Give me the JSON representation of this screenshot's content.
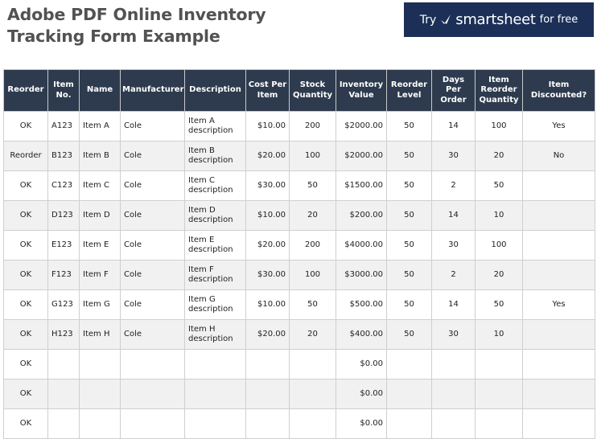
{
  "title": "Adobe PDF Online Inventory Tracking Form Example",
  "promo": {
    "try": "Try",
    "brand": "smartsheet",
    "free": "for free",
    "color": "#1b2f57"
  },
  "table": {
    "headers": [
      "Reorder",
      "Item No.",
      "Name",
      "Manufacturer",
      "Description",
      "Cost Per Item",
      "Stock Quantity",
      "Inventory Value",
      "Reorder Level",
      "Days Per Order",
      "Item Reorder Quantity",
      "Item Discounted?"
    ],
    "rows": [
      [
        "OK",
        "A123",
        "Item A",
        "Cole",
        "Item A description",
        "$10.00",
        "200",
        "$2000.00",
        "50",
        "14",
        "100",
        "Yes"
      ],
      [
        "Reorder",
        "B123",
        "Item B",
        "Cole",
        "Item B description",
        "$20.00",
        "100",
        "$2000.00",
        "50",
        "30",
        "20",
        "No"
      ],
      [
        "OK",
        "C123",
        "Item C",
        "Cole",
        "Item C description",
        "$30.00",
        "50",
        "$1500.00",
        "50",
        "2",
        "50",
        ""
      ],
      [
        "OK",
        "D123",
        "Item D",
        "Cole",
        "Item D description",
        "$10.00",
        "20",
        "$200.00",
        "50",
        "14",
        "10",
        ""
      ],
      [
        "OK",
        "E123",
        "Item E",
        "Cole",
        "Item E description",
        "$20.00",
        "200",
        "$4000.00",
        "50",
        "30",
        "100",
        ""
      ],
      [
        "OK",
        "F123",
        "Item F",
        "Cole",
        "Item F description",
        "$30.00",
        "100",
        "$3000.00",
        "50",
        "2",
        "20",
        ""
      ],
      [
        "OK",
        "G123",
        "Item G",
        "Cole",
        "Item G description",
        "$10.00",
        "50",
        "$500.00",
        "50",
        "14",
        "50",
        "Yes"
      ],
      [
        "OK",
        "H123",
        "Item H",
        "Cole",
        "Item H description",
        "$20.00",
        "20",
        "$400.00",
        "50",
        "30",
        "10",
        ""
      ],
      [
        "OK",
        "",
        "",
        "",
        "",
        "",
        "",
        "$0.00",
        "",
        "",
        "",
        ""
      ],
      [
        "OK",
        "",
        "",
        "",
        "",
        "",
        "",
        "$0.00",
        "",
        "",
        "",
        ""
      ],
      [
        "OK",
        "",
        "",
        "",
        "",
        "",
        "",
        "$0.00",
        "",
        "",
        "",
        ""
      ]
    ]
  }
}
